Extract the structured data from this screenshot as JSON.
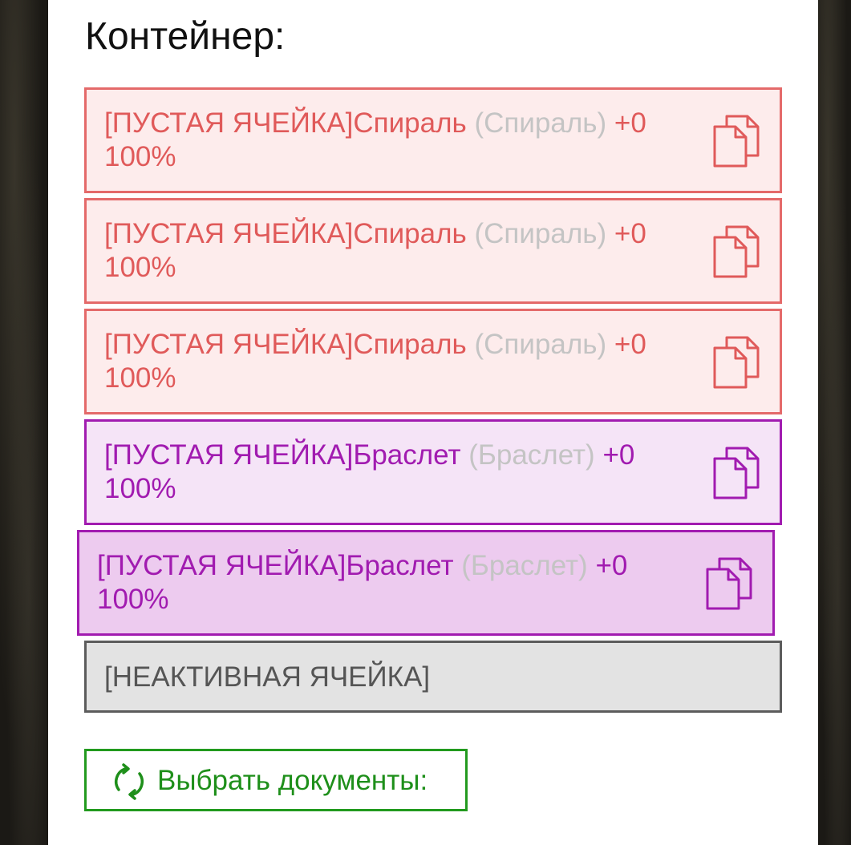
{
  "container": {
    "title": "Контейнер:"
  },
  "slots": [
    {
      "prefix": "[ПУСТАЯ ЯЧЕЙКА]",
      "name": "Спираль",
      "alt": "(Спираль)",
      "bonus": "+0",
      "condition": "100%"
    },
    {
      "prefix": "[ПУСТАЯ ЯЧЕЙКА]",
      "name": "Спираль",
      "alt": "(Спираль)",
      "bonus": "+0",
      "condition": "100%"
    },
    {
      "prefix": "[ПУСТАЯ ЯЧЕЙКА]",
      "name": "Спираль",
      "alt": "(Спираль)",
      "bonus": "+0",
      "condition": "100%"
    },
    {
      "prefix": "[ПУСТАЯ ЯЧЕЙКА]",
      "name": "Браслет",
      "alt": "(Браслет)",
      "bonus": "+0",
      "condition": "100%"
    },
    {
      "prefix": "[ПУСТАЯ ЯЧЕЙКА]",
      "name": "Браслет",
      "alt": "(Браслет)",
      "bonus": "+0",
      "condition": "100%"
    }
  ],
  "inactive_slot": {
    "label": "[НЕАКТИВНАЯ ЯЧЕЙКА]"
  },
  "select_button": {
    "label": "Выбрать документы:",
    "icon": "refresh-icon"
  },
  "colors": {
    "red_border": "#e46a6a",
    "red_text": "#e05a5a",
    "red_bg": "#fdecec",
    "purple_border": "#a11bb0",
    "purple_bg": "#f5e4f7",
    "purple_bg_active": "#edcbef",
    "inactive_bg": "#e3e3e3",
    "button_green": "#229a1e",
    "alt_text": "#c4c4c4"
  }
}
